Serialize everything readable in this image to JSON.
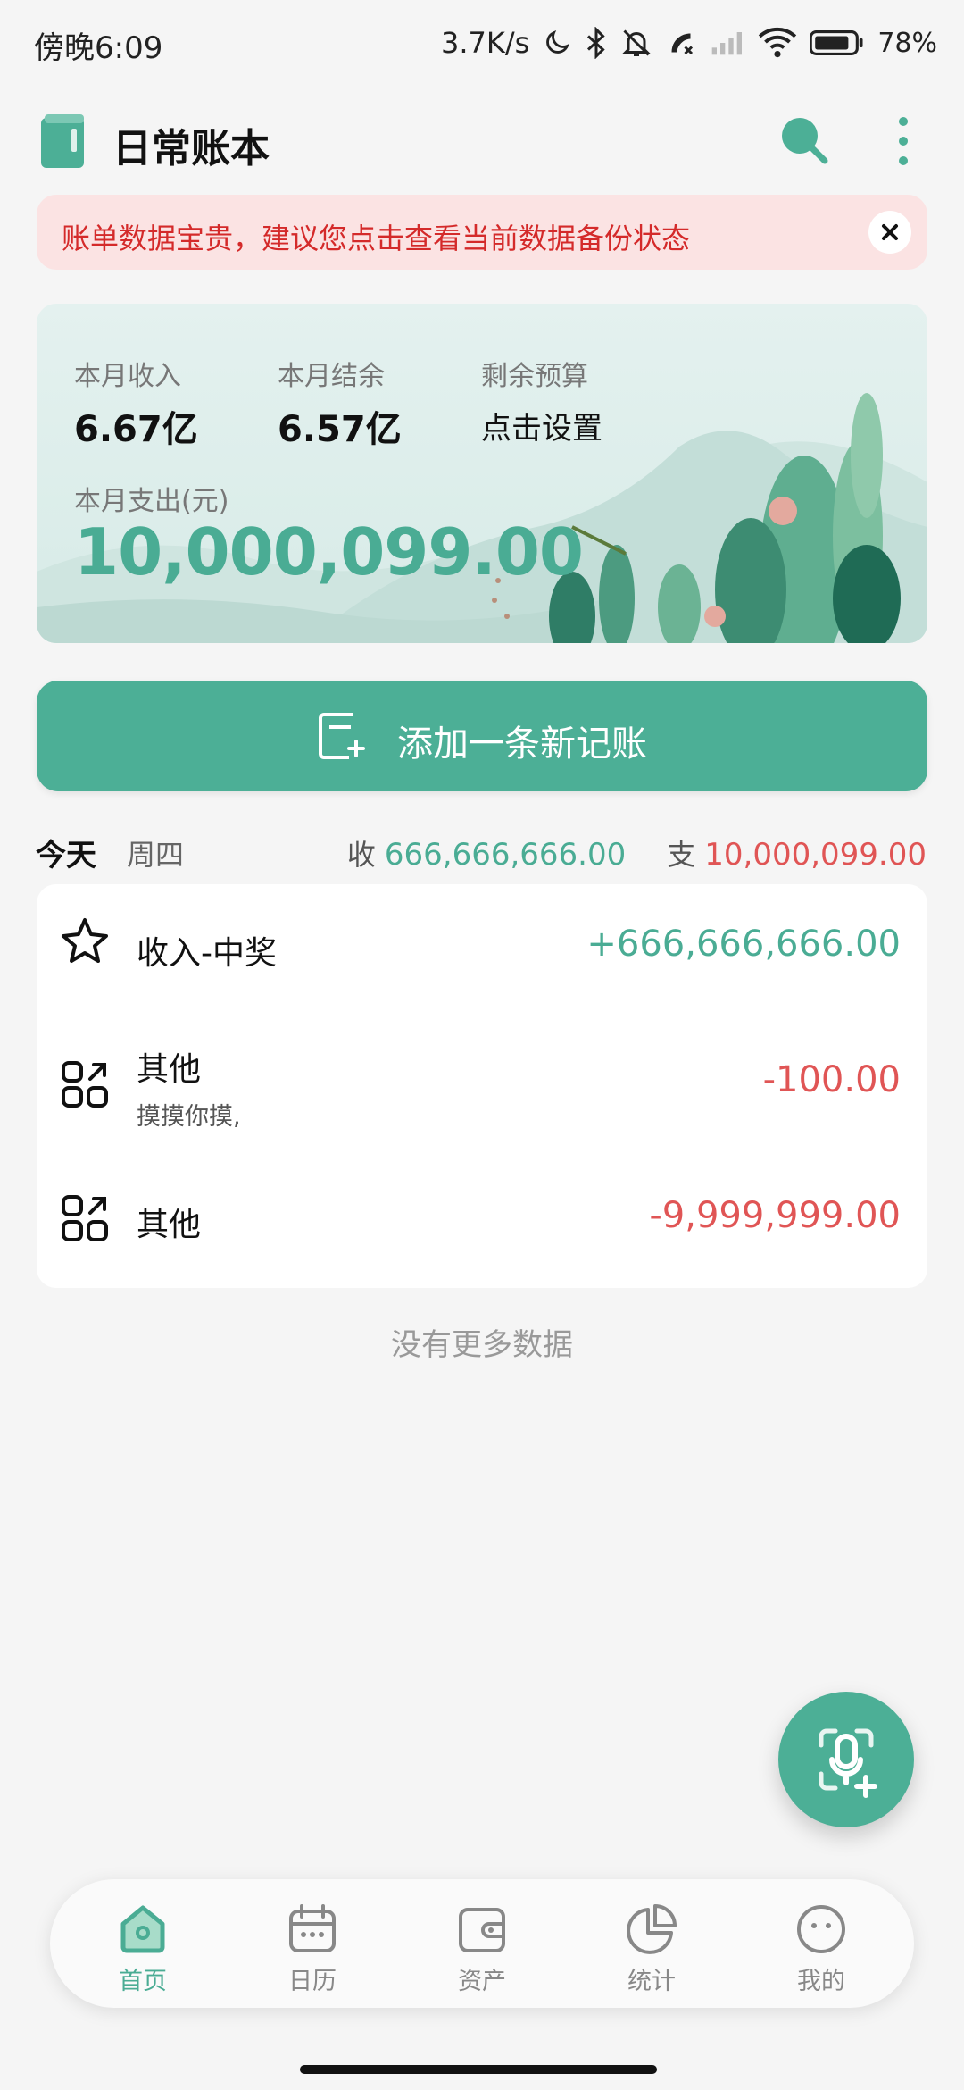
{
  "status_bar": {
    "time": "傍晚6:09",
    "network_speed": "3.7K/s",
    "battery_percent": "78%"
  },
  "app_bar": {
    "title": "日常账本",
    "icons": [
      "book-logo-icon",
      "search-icon",
      "more-vertical-icon"
    ]
  },
  "notice": {
    "text": "账单数据宝贵，建议您点击查看当前数据备份状态",
    "close_icon": "close-icon"
  },
  "summary": {
    "income_label": "本月收入",
    "income_value": "6.67亿",
    "balance_label": "本月结余",
    "balance_value": "6.57亿",
    "budget_label": "剩余预算",
    "budget_value": "点击设置",
    "expense_label": "本月支出(元)",
    "expense_value": "10,000,099.00"
  },
  "add_button": {
    "label": "添加一条新记账",
    "icon": "add-record-icon"
  },
  "day_group": {
    "today": "今天",
    "weekday": "周四",
    "income_label": "收",
    "income_total": "666,666,666.00",
    "expense_label": "支",
    "expense_total": "10,000,099.00"
  },
  "records": [
    {
      "title": "收入-中奖",
      "note": "",
      "amount": "+666,666,666.00",
      "type": "income",
      "icon": "prize-icon"
    },
    {
      "title": "其他",
      "note": "摸摸你摸,",
      "amount": "-100.00",
      "type": "expense",
      "icon": "other-category-icon"
    },
    {
      "title": "其他",
      "note": "",
      "amount": "-9,999,999.00",
      "type": "expense",
      "icon": "other-category-icon"
    }
  ],
  "list_footer": "没有更多数据",
  "fab": {
    "icon": "voice-add-icon"
  },
  "bottom_nav": [
    {
      "label": "首页",
      "icon": "home-icon",
      "active": true
    },
    {
      "label": "日历",
      "icon": "calendar-icon",
      "active": false
    },
    {
      "label": "资产",
      "icon": "wallet-icon",
      "active": false
    },
    {
      "label": "统计",
      "icon": "pie-chart-icon",
      "active": false
    },
    {
      "label": "我的",
      "icon": "profile-icon",
      "active": false
    }
  ],
  "colors": {
    "accent": "#4caf96",
    "income": "#4aac94",
    "expense": "#e05555",
    "notice_bg": "#fbe3e3",
    "notice_text": "#d42a2a"
  }
}
